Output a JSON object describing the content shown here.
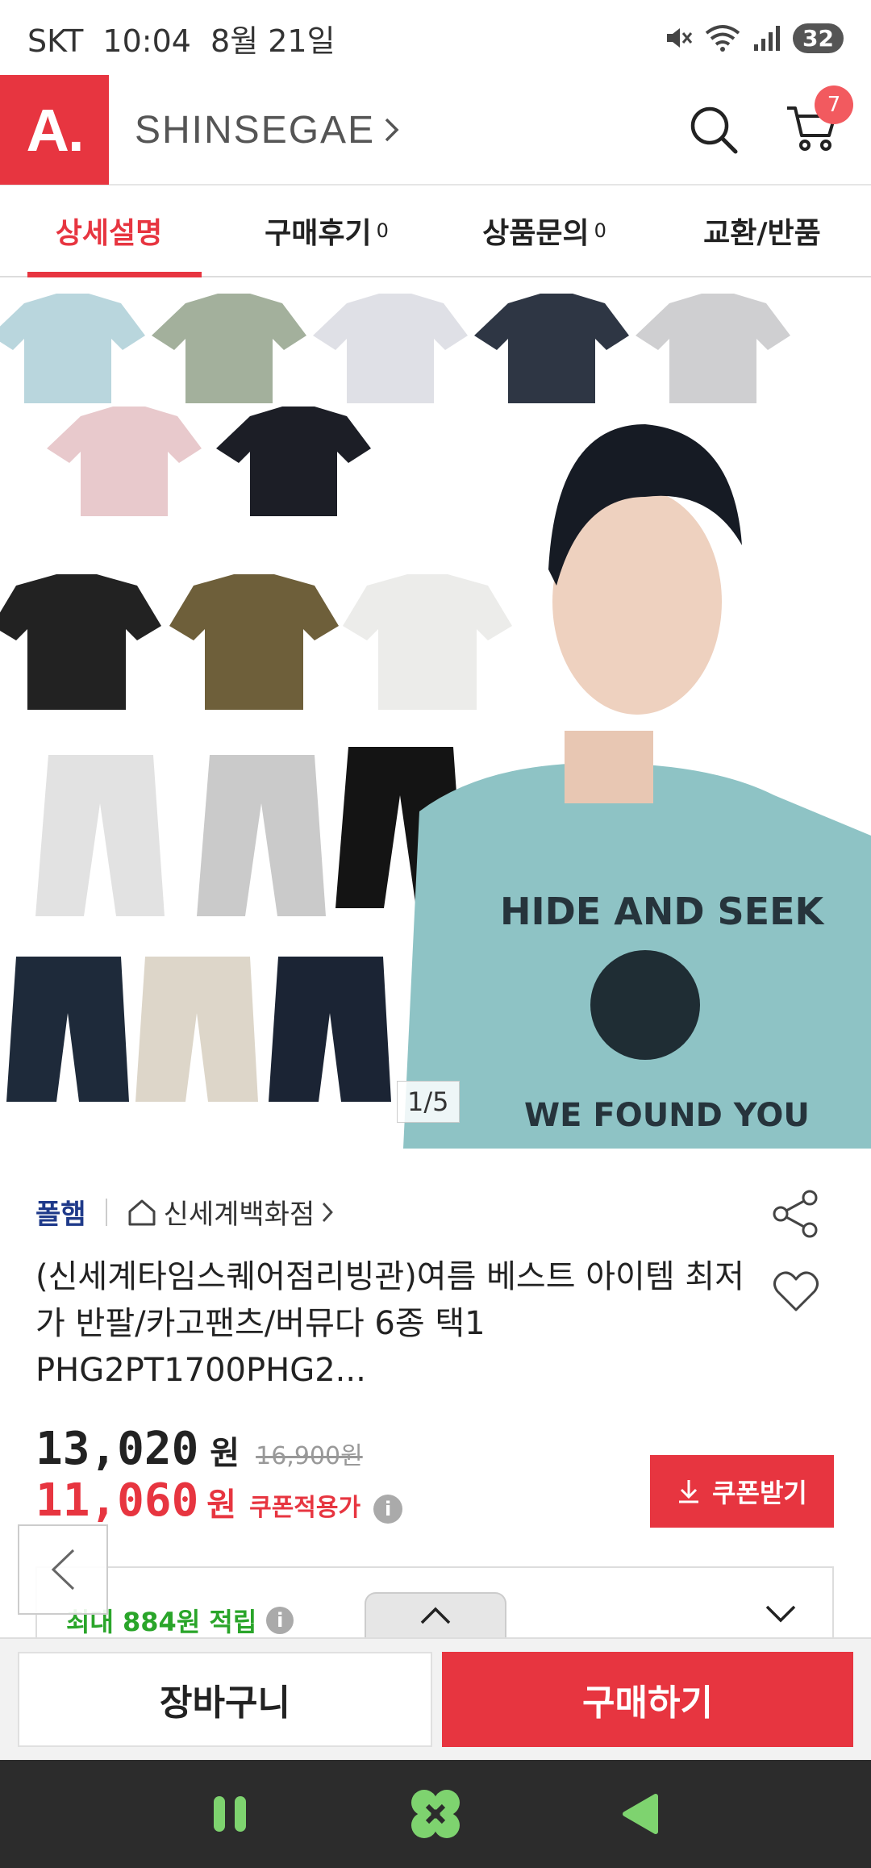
{
  "status": {
    "carrier": "SKT",
    "time": "10:04",
    "date": "8월 21일",
    "battery": "32"
  },
  "header": {
    "logo_text": "A.",
    "brand": "SHINSEGAE",
    "cart_count": "7"
  },
  "tabs": [
    {
      "label": "상세설명",
      "count": "",
      "active": true
    },
    {
      "label": "구매후기",
      "count": "0",
      "active": false
    },
    {
      "label": "상품문의",
      "count": "0",
      "active": false
    },
    {
      "label": "교환/반품",
      "count": "",
      "active": false
    }
  ],
  "gallery": {
    "counter": "1/5",
    "shirt_print_line1": "HIDE AND SEEK",
    "shirt_print_line2": "WE FOUND YOU"
  },
  "product": {
    "brand": "폴햄",
    "store": "신세계백화점",
    "title": "(신세계타임스퀘어점리빙관)여름 베스트 아이템 최저가 반팔/카고팬츠/버뮤다 6종 택1 PHG2PT1700PHG2...",
    "price": "13,020",
    "price_unit": "원",
    "original_price": "16,900원",
    "coupon_price": "11,060",
    "coupon_unit": "원",
    "coupon_price_label": "쿠폰적용가",
    "coupon_button": "쿠폰받기",
    "points": "최대 884원 적립"
  },
  "actions": {
    "cart": "장바구니",
    "buy": "구매하기"
  },
  "colors": {
    "accent": "#e73540",
    "brand_blue": "#1f3a8a",
    "points_green": "#2aa52a"
  }
}
